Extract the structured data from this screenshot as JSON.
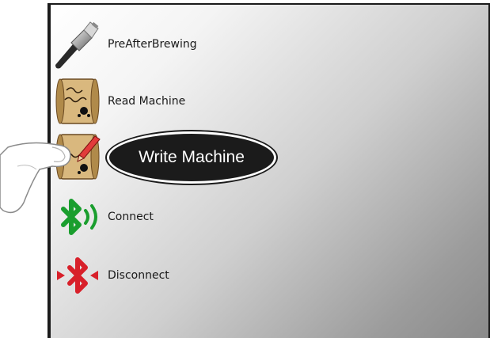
{
  "menu": {
    "items": [
      {
        "key": "pre-after-brewing",
        "label": "PreAfterBrewing",
        "icon": "portafilter-icon"
      },
      {
        "key": "read-machine",
        "label": "Read Machine",
        "icon": "scroll-icon"
      },
      {
        "key": "write-machine",
        "label": "",
        "icon": "scroll-pen-icon"
      },
      {
        "key": "connect",
        "label": "Connect",
        "icon": "bluetooth-connect-icon"
      },
      {
        "key": "disconnect",
        "label": "Disconnect",
        "icon": "bluetooth-disconnect-icon"
      }
    ]
  },
  "callout": {
    "label": "Write Machine"
  },
  "colors": {
    "bluetooth_connect": "#1a9e2e",
    "bluetooth_disconnect": "#d8202a",
    "callout_bg": "#1b1b1b",
    "scroll": "#c9a56a"
  }
}
